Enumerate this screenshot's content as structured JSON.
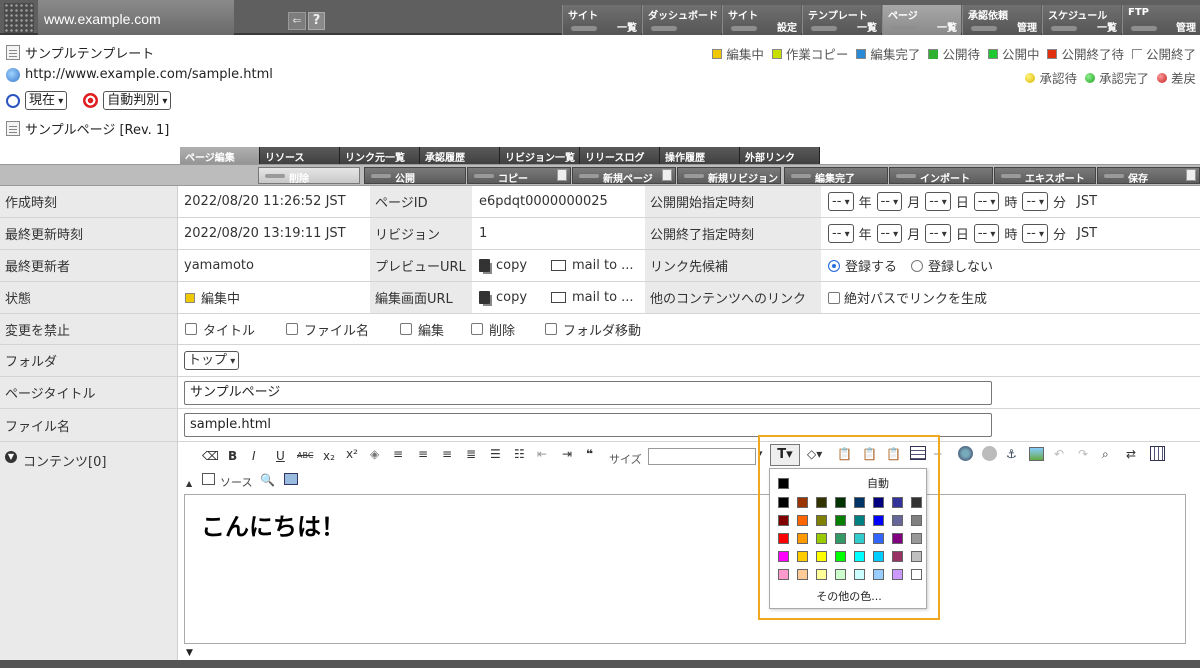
{
  "header": {
    "site_url": "www.example.com",
    "nav": [
      {
        "l1": "サイト",
        "l2": "一覧"
      },
      {
        "l1": "ダッシュボード",
        "l2": ""
      },
      {
        "l1": "サイト",
        "l2": "設定"
      },
      {
        "l1": "テンプレート",
        "l2": "一覧"
      },
      {
        "l1": "ページ",
        "l2": "一覧"
      },
      {
        "l1": "承認依頼",
        "l2": "管理"
      },
      {
        "l1": "スケジュール",
        "l2": "一覧"
      },
      {
        "l1": "FTP",
        "l2": "管理"
      }
    ]
  },
  "page_info": {
    "template": "サンプルテンプレート",
    "url": "http://www.example.com/sample.html",
    "time_select": "現在",
    "auto_select": "自動判別",
    "page_name": "サンプルページ [Rev. 1]"
  },
  "legend": {
    "status": [
      {
        "label": "編集中",
        "color": "#f0c800"
      },
      {
        "label": "作業コピー",
        "color": "#c8e000"
      },
      {
        "label": "編集完了",
        "color": "#2a8ad8"
      },
      {
        "label": "公開待",
        "color": "#30b030"
      },
      {
        "label": "公開中",
        "color": "#1ec830"
      },
      {
        "label": "公開終了待",
        "color": "#e03010"
      },
      {
        "label": "公開終了",
        "color": "#ffffff"
      }
    ],
    "approval": [
      {
        "label": "承認待",
        "color": "#e8c800"
      },
      {
        "label": "承認完了",
        "color": "#30c030"
      },
      {
        "label": "差戻",
        "color": "#d03030"
      }
    ]
  },
  "tabs": [
    "ページ編集",
    "リソース",
    "リンク元一覧",
    "承認履歴",
    "リビジョン一覧",
    "リリースログ",
    "操作履歴",
    "外部リンク"
  ],
  "actions": [
    "削除",
    "公開",
    "コピー",
    "新規ページ",
    "新規リビジョン",
    "編集完了",
    "インポート",
    "エキスポート",
    "保存"
  ],
  "form": {
    "created_label": "作成時刻",
    "created_value": "2022/08/20 11:26:52 JST",
    "page_id_label": "ページID",
    "page_id_value": "e6pdqt0000000025",
    "pub_start_label": "公開開始指定時刻",
    "updated_label": "最終更新時刻",
    "updated_value": "2022/08/20 13:19:11 JST",
    "revision_label": "リビジョン",
    "revision_value": "1",
    "pub_end_label": "公開終了指定時刻",
    "date_placeholder": "--",
    "unit_year": "年",
    "unit_month": "月",
    "unit_day": "日",
    "unit_hour": "時",
    "unit_minute": "分",
    "tz": "JST",
    "updater_label": "最終更新者",
    "updater_value": "yamamoto",
    "preview_label": "プレビューURL",
    "copy_label": "copy",
    "mail_label": "mail to ...",
    "link_cand_label": "リンク先候補",
    "register_yes": "登録する",
    "register_no": "登録しない",
    "status_label": "状態",
    "status_value": "編集中",
    "edit_url_label": "編集画面URL",
    "other_link_label": "他のコンテンツへのリンク",
    "abs_path_label": "絶対パスでリンクを生成",
    "lock_label": "変更を禁止",
    "lock_opts": [
      "タイトル",
      "ファイル名",
      "編集",
      "削除",
      "フォルダ移動"
    ],
    "folder_label": "フォルダ",
    "folder_value": "トップ",
    "title_label": "ページタイトル",
    "title_value": "サンプルページ",
    "filename_label": "ファイル名",
    "filename_value": "sample.html",
    "contents_label": "コンテンツ[0]"
  },
  "editor": {
    "size_label": "サイズ",
    "source_label": "ソース",
    "content": "こんにちは！"
  },
  "palette": {
    "auto_label": "自動",
    "more_label": "その他の色...",
    "colors": [
      [
        "#000000",
        "#993300",
        "#333300",
        "#003300",
        "#003366",
        "#000080",
        "#333399",
        "#333333"
      ],
      [
        "#800000",
        "#FF6600",
        "#808000",
        "#008000",
        "#008080",
        "#0000FF",
        "#666699",
        "#808080"
      ],
      [
        "#FF0000",
        "#FF9900",
        "#99CC00",
        "#339966",
        "#33CCCC",
        "#3366FF",
        "#800080",
        "#999999"
      ],
      [
        "#FF00FF",
        "#FFCC00",
        "#FFFF00",
        "#00FF00",
        "#00FFFF",
        "#00CCFF",
        "#993366",
        "#C0C0C0"
      ],
      [
        "#FF99CC",
        "#FFCC99",
        "#FFFF99",
        "#CCFFCC",
        "#CCFFFF",
        "#99CCFF",
        "#CC99FF",
        "#FFFFFF"
      ]
    ]
  }
}
